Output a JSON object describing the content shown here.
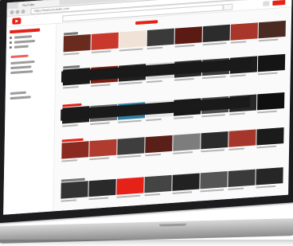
{
  "browser": {
    "tab_title": "YouTube",
    "url": "https://www.youtube.com"
  },
  "icons": {
    "logo": "youtube-logo-icon",
    "search": "search-icon",
    "menu": "hamburger-menu-icon",
    "upload": "upload-icon"
  },
  "colors": {
    "brand": "#e62117",
    "bezel": "#1c1c1e",
    "background": "#fafafa"
  },
  "rows": [
    {
      "thumbs": [
        "#6a2b1f",
        "#c9392b",
        "#f0e2d6",
        "#3a3a3a",
        "#5b1a14",
        "#2c2c2c",
        "#a8362a",
        "#4b2a22"
      ]
    },
    {
      "thumbs": [
        "#1a1a1a",
        "#7b1d12",
        "#222222",
        "#d8d8d8",
        "#2a2a2a",
        "#3b3b3b",
        "#1d1d1d",
        "#151515"
      ]
    },
    {
      "thumbs": [
        "#1e1e1e",
        "#6d6d6d",
        "#2f7fa3",
        "#e6e6e6",
        "#181818",
        "#4c4c4c",
        "#272727",
        "#0f0f0f"
      ]
    },
    {
      "thumbs": [
        "#8a2a20",
        "#b03b2f",
        "#3e3e3e",
        "#5a1f18",
        "#7d7d7d",
        "#2b2b2b",
        "#a5362b",
        "#1b1b1b"
      ]
    },
    {
      "thumbs": [
        "#333333",
        "#2a2a2a",
        "#e62117",
        "#444444",
        "#222222",
        "#555555",
        "#3a3a3a",
        "#262626"
      ]
    }
  ]
}
